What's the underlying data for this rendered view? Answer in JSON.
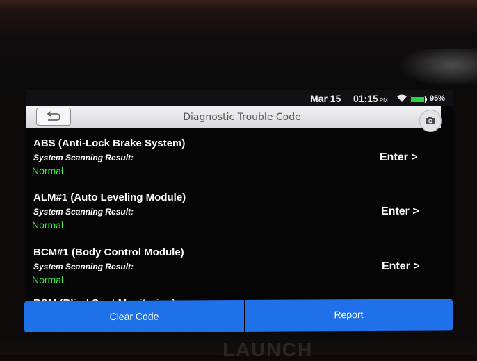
{
  "status_bar": {
    "date": "Mar 15",
    "time": "01:15",
    "ampm": "PM",
    "battery": "95%",
    "wifi_icon": "wifi-icon",
    "battery_icon": "battery-icon"
  },
  "header": {
    "title": "Diagnostic Trouble Code",
    "back_icon": "back-arrow-icon",
    "snapshot_icon": "camera-icon"
  },
  "modules": [
    {
      "name": "ABS (Anti-Lock Brake System)",
      "label": "System Scanning Result:",
      "result": "Normal",
      "action": "Enter >"
    },
    {
      "name": "ALM#1 (Auto Leveling Module)",
      "label": "System Scanning Result:",
      "result": "Normal",
      "action": "Enter >"
    },
    {
      "name": "BCM#1 (Body Control Module)",
      "label": "System Scanning Result:",
      "result": "Normal",
      "action": "Enter >"
    },
    {
      "name": "BSM (Blind Spot Monitoring)"
    }
  ],
  "footer": {
    "clear_label": "Clear Code",
    "report_label": "Report"
  },
  "device": {
    "brand": "LAUNCH"
  },
  "colors": {
    "accent": "#1f71ea",
    "normal_status": "#3ce84a"
  }
}
